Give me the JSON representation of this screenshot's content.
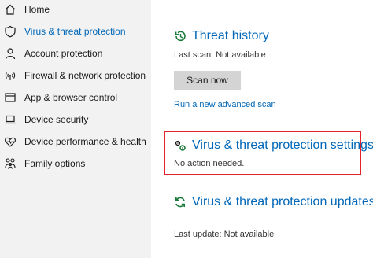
{
  "sidebar": {
    "items": [
      {
        "label": "Home",
        "icon": "home-icon"
      },
      {
        "label": "Virus & threat protection",
        "icon": "shield-icon",
        "active": true
      },
      {
        "label": "Account protection",
        "icon": "person-icon"
      },
      {
        "label": "Firewall & network protection",
        "icon": "wifi-icon"
      },
      {
        "label": "App & browser control",
        "icon": "app-window-icon"
      },
      {
        "label": "Device security",
        "icon": "laptop-icon"
      },
      {
        "label": "Device performance & health",
        "icon": "heart-icon"
      },
      {
        "label": "Family options",
        "icon": "family-icon"
      }
    ]
  },
  "threat_history": {
    "title": "Threat history",
    "last_scan": "Last scan:  Not available",
    "scan_button": "Scan now",
    "advanced_link": "Run a new advanced scan"
  },
  "settings": {
    "title": "Virus & threat protection settings",
    "status": "No action needed."
  },
  "updates": {
    "title": "Virus & threat protection updates",
    "last_update": "Last update: Not available"
  },
  "colors": {
    "accent": "#0067b8",
    "sidebar_bg": "#f2f2f2",
    "highlight": "#e8202a",
    "button_bg": "#d4d4d4"
  }
}
